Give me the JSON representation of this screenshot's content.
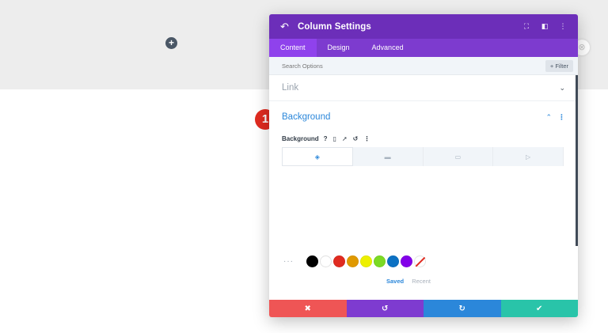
{
  "canvas": {
    "add_row_icon": "+",
    "close_icon": "⊗"
  },
  "step_badge": "1",
  "modal": {
    "title": "Column Settings",
    "header_icons": [
      "expand-icon",
      "split-view-icon",
      "more-vertical-icon"
    ],
    "tabs": [
      {
        "label": "Content",
        "active": true
      },
      {
        "label": "Design",
        "active": false
      },
      {
        "label": "Advanced",
        "active": false
      }
    ],
    "search": {
      "placeholder": "Search Options",
      "filter_label": "+ Filter"
    },
    "sections": {
      "link": {
        "title": "Link"
      },
      "background": {
        "title": "Background",
        "field_label": "Background",
        "field_icons": [
          "help-icon",
          "mobile-icon",
          "hover-icon",
          "reset-icon",
          "more-vertical-icon"
        ],
        "bg_type_tabs": [
          "color-icon",
          "gradient-icon",
          "image-icon",
          "video-icon"
        ]
      }
    },
    "swatches": {
      "more_label": "···",
      "colors": [
        "#000000",
        "#ffffff",
        "#e02b20",
        "#e09900",
        "#edf000",
        "#7cda24",
        "#0c71c3",
        "#8300e9"
      ],
      "saved_label": "Saved",
      "recent_label": "Recent"
    },
    "footer": [
      {
        "name": "cancel",
        "icon": "✖",
        "color": "#ef5555"
      },
      {
        "name": "undo",
        "icon": "↺",
        "color": "#7e3bd0"
      },
      {
        "name": "redo",
        "icon": "↻",
        "color": "#2b87da"
      },
      {
        "name": "save",
        "icon": "✔",
        "color": "#29c4a9"
      }
    ],
    "colors": {
      "header": "#6c2eb9",
      "tabs": "#7d3bcf",
      "active_tab": "#8f42ec",
      "accent": "#2b87da"
    }
  }
}
